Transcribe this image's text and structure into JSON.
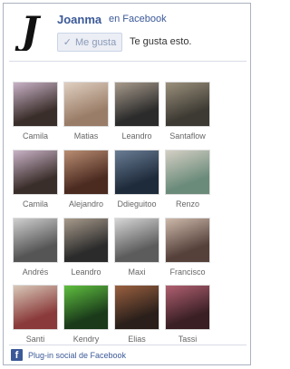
{
  "header": {
    "page_name": "Joanma",
    "on_facebook": "en Facebook",
    "like_button_label": "Me gusta",
    "like_text": "Te gusta esto."
  },
  "friends": [
    {
      "name": "Camila",
      "c1": "#3a2e2a",
      "c2": "#c9b2c7"
    },
    {
      "name": "Matias",
      "c1": "#9a7d68",
      "c2": "#e0cfc0"
    },
    {
      "name": "Leandro",
      "c1": "#2b2b2b",
      "c2": "#a89b8c"
    },
    {
      "name": "Santaflow",
      "c1": "#3d3a33",
      "c2": "#9b907c"
    },
    {
      "name": "Camila",
      "c1": "#3a2e2a",
      "c2": "#c9b2c7"
    },
    {
      "name": "Alejandro",
      "c1": "#4b2a20",
      "c2": "#b98d72"
    },
    {
      "name": "Ddieguitoo",
      "c1": "#1e2b3b",
      "c2": "#6a7d95"
    },
    {
      "name": "Renzo",
      "c1": "#6b8b7a",
      "c2": "#d4cfc4"
    },
    {
      "name": "Andrés",
      "c1": "#555555",
      "c2": "#cfcfcf"
    },
    {
      "name": "Leandro",
      "c1": "#2b2b2b",
      "c2": "#a89b8c"
    },
    {
      "name": "Maxi",
      "c1": "#5c5c5c",
      "c2": "#d6d6d6"
    },
    {
      "name": "Francisco",
      "c1": "#55403a",
      "c2": "#cdb9aa"
    },
    {
      "name": "Santi",
      "c1": "#8a3a3a",
      "c2": "#d8c8b8"
    },
    {
      "name": "Kendry",
      "c1": "#1a3a1a",
      "c2": "#5fbf3f"
    },
    {
      "name": "Elias",
      "c1": "#2a1f1a",
      "c2": "#9a6040"
    },
    {
      "name": "Tassi",
      "c1": "#3a1f25",
      "c2": "#b06070"
    }
  ],
  "footer": {
    "fb_letter": "f",
    "text": "Plug-in social de Facebook"
  },
  "colors": {
    "brand": "#3b5998",
    "border": "#aab2bf"
  }
}
